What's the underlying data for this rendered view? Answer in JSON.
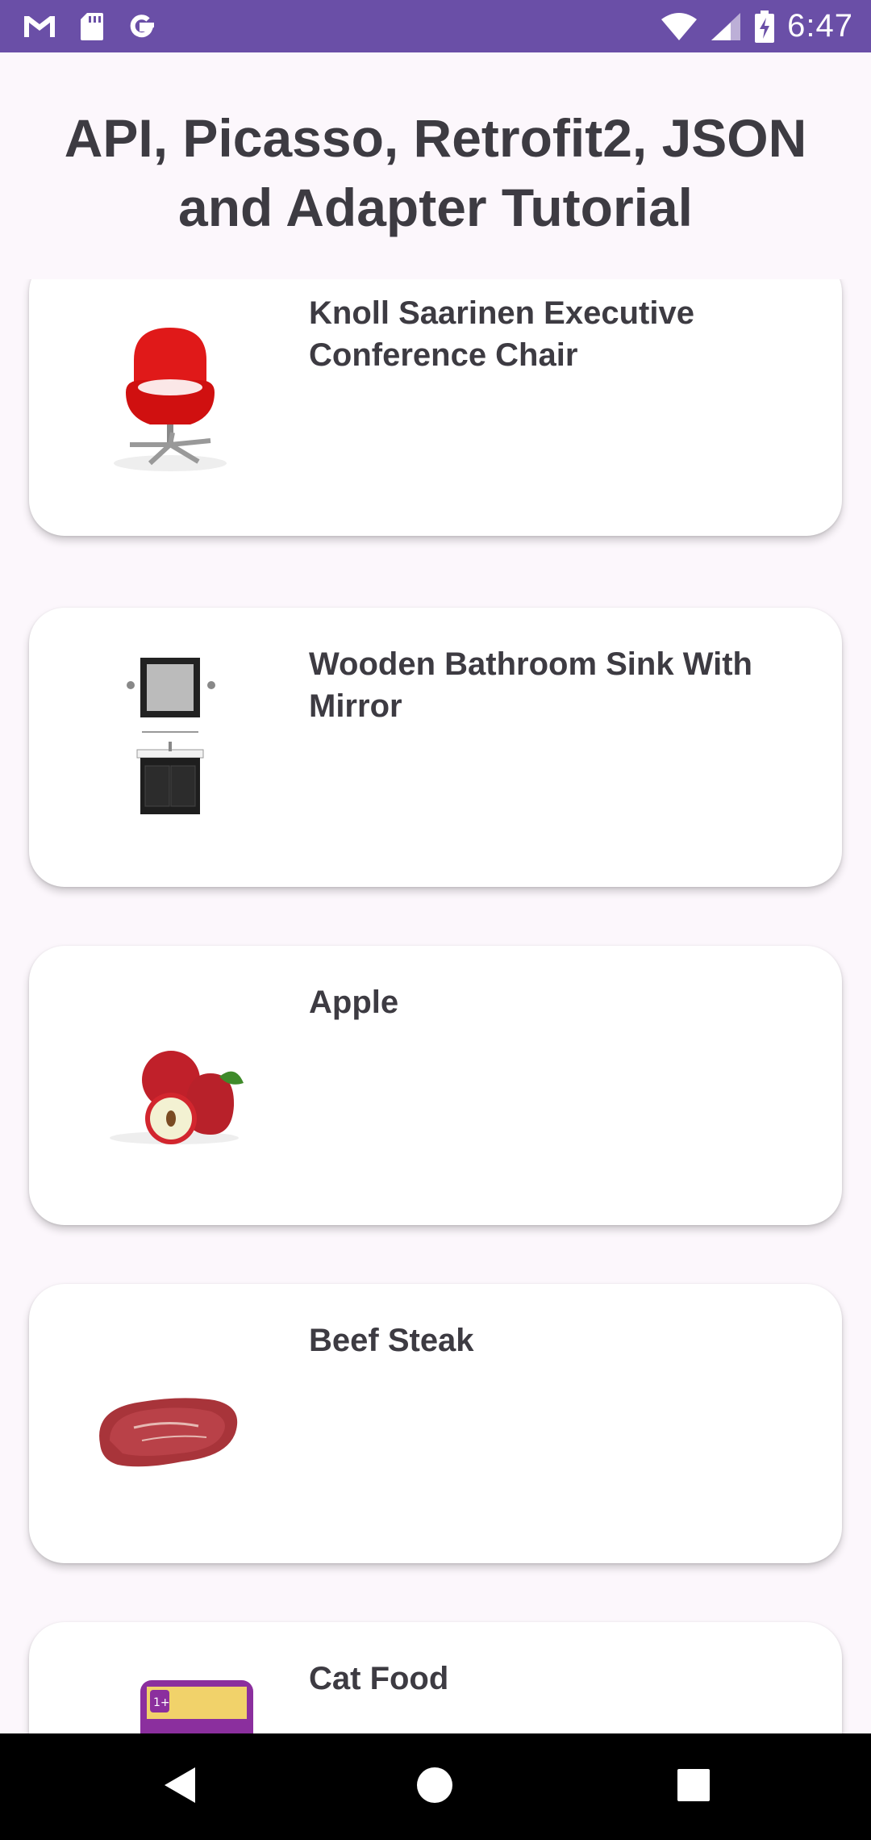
{
  "status_bar": {
    "time": "6:47",
    "left_icons": [
      "gmail-icon",
      "sd-card-icon",
      "google-icon"
    ],
    "right_icons": [
      "wifi-icon",
      "cell-signal-icon",
      "battery-icon"
    ],
    "background": "#6a4fa7"
  },
  "header": {
    "title": "API, Picasso, Retrofit2, JSON and Adapter Tutorial"
  },
  "items": [
    {
      "title": "Knoll Saarinen Executive Conference Chair",
      "image": "office-chair-image"
    },
    {
      "title": "Wooden Bathroom Sink With Mirror",
      "image": "bathroom-sink-mirror-image"
    },
    {
      "title": "Apple",
      "image": "apples-image"
    },
    {
      "title": "Beef Steak",
      "image": "beef-steak-image"
    },
    {
      "title": "Cat Food",
      "image": "cat-food-pouch-image"
    }
  ],
  "nav_bar": {
    "buttons": [
      "back-icon",
      "home-icon",
      "recents-icon"
    ]
  }
}
